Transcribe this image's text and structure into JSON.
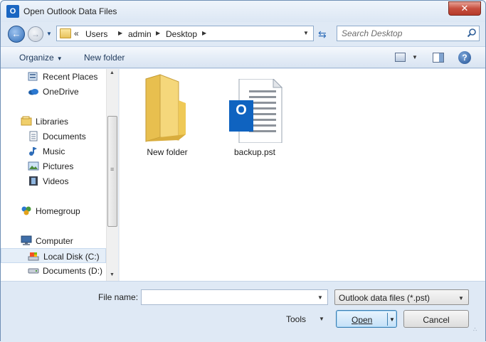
{
  "window": {
    "title": "Open Outlook Data Files",
    "app_icon_letter": "O",
    "close_glyph": "✕"
  },
  "nav": {
    "back_glyph": "←",
    "forward_glyph": "→"
  },
  "address": {
    "overflow": "«",
    "crumbs": [
      "Users",
      "admin",
      "Desktop"
    ]
  },
  "search": {
    "placeholder": "Search Desktop"
  },
  "toolbar": {
    "organize_label": "Organize",
    "new_folder_label": "New folder"
  },
  "sidebar": {
    "items": [
      {
        "label": "Recent Places",
        "icon": "recent-places-icon"
      },
      {
        "label": "OneDrive",
        "icon": "onedrive-icon"
      },
      {
        "label": "Libraries",
        "icon": "libraries-icon"
      },
      {
        "label": "Documents",
        "icon": "documents-icon"
      },
      {
        "label": "Music",
        "icon": "music-icon"
      },
      {
        "label": "Pictures",
        "icon": "pictures-icon"
      },
      {
        "label": "Videos",
        "icon": "videos-icon"
      },
      {
        "label": "Homegroup",
        "icon": "homegroup-icon"
      },
      {
        "label": "Computer",
        "icon": "computer-icon"
      },
      {
        "label": "Local Disk (C:)",
        "icon": "local-disk-icon",
        "selected": true
      },
      {
        "label": "Documents (D:)",
        "icon": "drive-icon"
      }
    ]
  },
  "files": [
    {
      "name": "New folder",
      "icon": "folder-icon"
    },
    {
      "name": "backup.pst",
      "icon": "outlook-data-file-icon",
      "badge_letter": "O"
    }
  ],
  "footer": {
    "file_name_label": "File name:",
    "file_name_value": "",
    "file_type_value": "Outlook data files (*.pst)",
    "tools_label": "Tools",
    "open_label": "Open",
    "cancel_label": "Cancel"
  },
  "colors": {
    "accent": "#1a66c2",
    "close": "#c7503f",
    "folder": "#f0cf6b",
    "outlook_blue": "#0f63c0"
  }
}
